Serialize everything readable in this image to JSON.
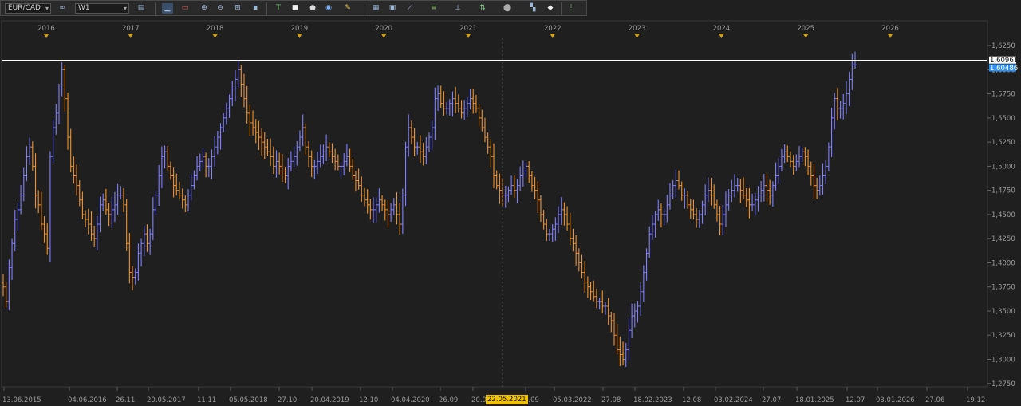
{
  "toolbar": {
    "symbol": "EUR/CAD",
    "timeframe": "W1",
    "icons": [
      "bar-type-icon",
      "zoom-in-icon",
      "zoom-out-icon",
      "grid-icon",
      "crosshair-icon",
      "text-tool-icon",
      "shape-icon",
      "circle-icon",
      "pencil-icon",
      "chart-icon",
      "template-icon",
      "line-tool-icon",
      "channel-icon",
      "fibo-icon",
      "arrows-icon",
      "sphere-icon",
      "eraser-icon",
      "signal-icon"
    ]
  },
  "crosshair_date": "22.05.2021",
  "chart_data": {
    "type": "bar",
    "instrument": "EUR/CAD",
    "timeframe": "W1",
    "year_markers": [
      "2016",
      "2017",
      "2018",
      "2019",
      "2020",
      "2021",
      "2022",
      "2023",
      "2024",
      "2025",
      "2026"
    ],
    "x_ticks": [
      "13.06.2015",
      "04.06.2016",
      "26.11",
      "20.05.2017",
      "11.11",
      "05.05.2018",
      "27.10",
      "20.04.2019",
      "12.10",
      "04.04.2020",
      "26.09",
      "20.0",
      "1.09",
      "05.03.2022",
      "27.08",
      "18.02.2023",
      "12.08",
      "03.02.2024",
      "27.07",
      "18.01.2025",
      "12.07",
      "03.01.2026",
      "27.06",
      "19.12"
    ],
    "y_ticks": [
      "1,6250",
      "1,6000",
      "1,5750",
      "1,5500",
      "1,5250",
      "1,5000",
      "1,4750",
      "1,4500",
      "1,4250",
      "1,4000",
      "1,3750",
      "1,3500",
      "1,3250",
      "1,3000",
      "1,2750"
    ],
    "ylim": [
      1.2715,
      1.6325
    ],
    "horizontal_level": 1.60961,
    "price_labels": {
      "level": "1,60961",
      "current": "1,60486"
    },
    "up_color": "#8080ff",
    "down_color": "#f0932b",
    "series": [
      {
        "values": [
          1.375,
          1.36,
          1.395,
          1.42,
          1.445,
          1.455,
          1.47,
          1.49,
          1.51,
          1.52,
          1.5,
          1.47,
          1.46,
          1.44,
          1.43,
          1.415,
          1.51,
          1.54,
          1.555,
          1.58,
          1.6,
          1.57,
          1.53,
          1.5,
          1.49,
          1.48,
          1.465,
          1.45,
          1.445,
          1.44,
          1.43,
          1.425,
          1.44,
          1.46,
          1.465,
          1.455,
          1.45,
          1.455,
          1.46,
          1.47,
          1.47,
          1.46,
          1.42,
          1.39,
          1.385,
          1.39,
          1.41,
          1.42,
          1.43,
          1.42,
          1.43,
          1.455,
          1.47,
          1.49,
          1.51,
          1.515,
          1.5,
          1.49,
          1.48,
          1.475,
          1.47,
          1.465,
          1.46,
          1.47,
          1.48,
          1.49,
          1.5,
          1.505,
          1.51,
          1.5,
          1.5,
          1.51,
          1.52,
          1.53,
          1.54,
          1.55,
          1.56,
          1.57,
          1.58,
          1.59,
          1.6,
          1.585,
          1.57,
          1.555,
          1.545,
          1.54,
          1.535,
          1.53,
          1.525,
          1.52,
          1.515,
          1.51,
          1.5,
          1.505,
          1.5,
          1.495,
          1.49,
          1.5,
          1.505,
          1.51,
          1.52,
          1.53,
          1.54,
          1.52,
          1.51,
          1.5,
          1.5,
          1.505,
          1.51,
          1.515,
          1.52,
          1.515,
          1.51,
          1.505,
          1.5,
          1.5,
          1.505,
          1.51,
          1.5,
          1.49,
          1.485,
          1.48,
          1.47,
          1.465,
          1.46,
          1.455,
          1.455,
          1.46,
          1.465,
          1.46,
          1.455,
          1.45,
          1.455,
          1.46,
          1.45,
          1.44,
          1.47,
          1.52,
          1.54,
          1.53,
          1.52,
          1.52,
          1.515,
          1.51,
          1.52,
          1.53,
          1.54,
          1.57,
          1.575,
          1.565,
          1.56,
          1.56,
          1.565,
          1.57,
          1.565,
          1.56,
          1.555,
          1.56,
          1.565,
          1.57,
          1.565,
          1.56,
          1.55,
          1.54,
          1.53,
          1.52,
          1.51,
          1.49,
          1.48,
          1.475,
          1.47,
          1.47,
          1.475,
          1.48,
          1.475,
          1.48,
          1.49,
          1.495,
          1.5,
          1.49,
          1.48,
          1.475,
          1.465,
          1.45,
          1.44,
          1.43,
          1.43,
          1.435,
          1.44,
          1.45,
          1.455,
          1.45,
          1.44,
          1.425,
          1.42,
          1.41,
          1.4,
          1.39,
          1.38,
          1.375,
          1.37,
          1.365,
          1.36,
          1.36,
          1.355,
          1.355,
          1.345,
          1.34,
          1.325,
          1.31,
          1.305,
          1.3,
          1.31,
          1.33,
          1.345,
          1.35,
          1.355,
          1.37,
          1.39,
          1.41,
          1.43,
          1.44,
          1.45,
          1.455,
          1.45,
          1.45,
          1.46,
          1.47,
          1.48,
          1.485,
          1.48,
          1.47,
          1.47,
          1.46,
          1.455,
          1.45,
          1.445,
          1.45,
          1.46,
          1.47,
          1.475,
          1.47,
          1.46,
          1.45,
          1.44,
          1.45,
          1.46,
          1.47,
          1.475,
          1.48,
          1.48,
          1.475,
          1.47,
          1.465,
          1.46,
          1.46,
          1.465,
          1.47,
          1.475,
          1.48,
          1.475,
          1.47,
          1.48,
          1.49,
          1.5,
          1.51,
          1.515,
          1.51,
          1.505,
          1.5,
          1.505,
          1.51,
          1.515,
          1.51,
          1.5,
          1.49,
          1.48,
          1.475,
          1.48,
          1.49,
          1.5,
          1.52,
          1.55,
          1.57,
          1.56,
          1.56,
          1.565,
          1.575,
          1.59,
          1.605,
          1.605
        ]
      }
    ]
  }
}
